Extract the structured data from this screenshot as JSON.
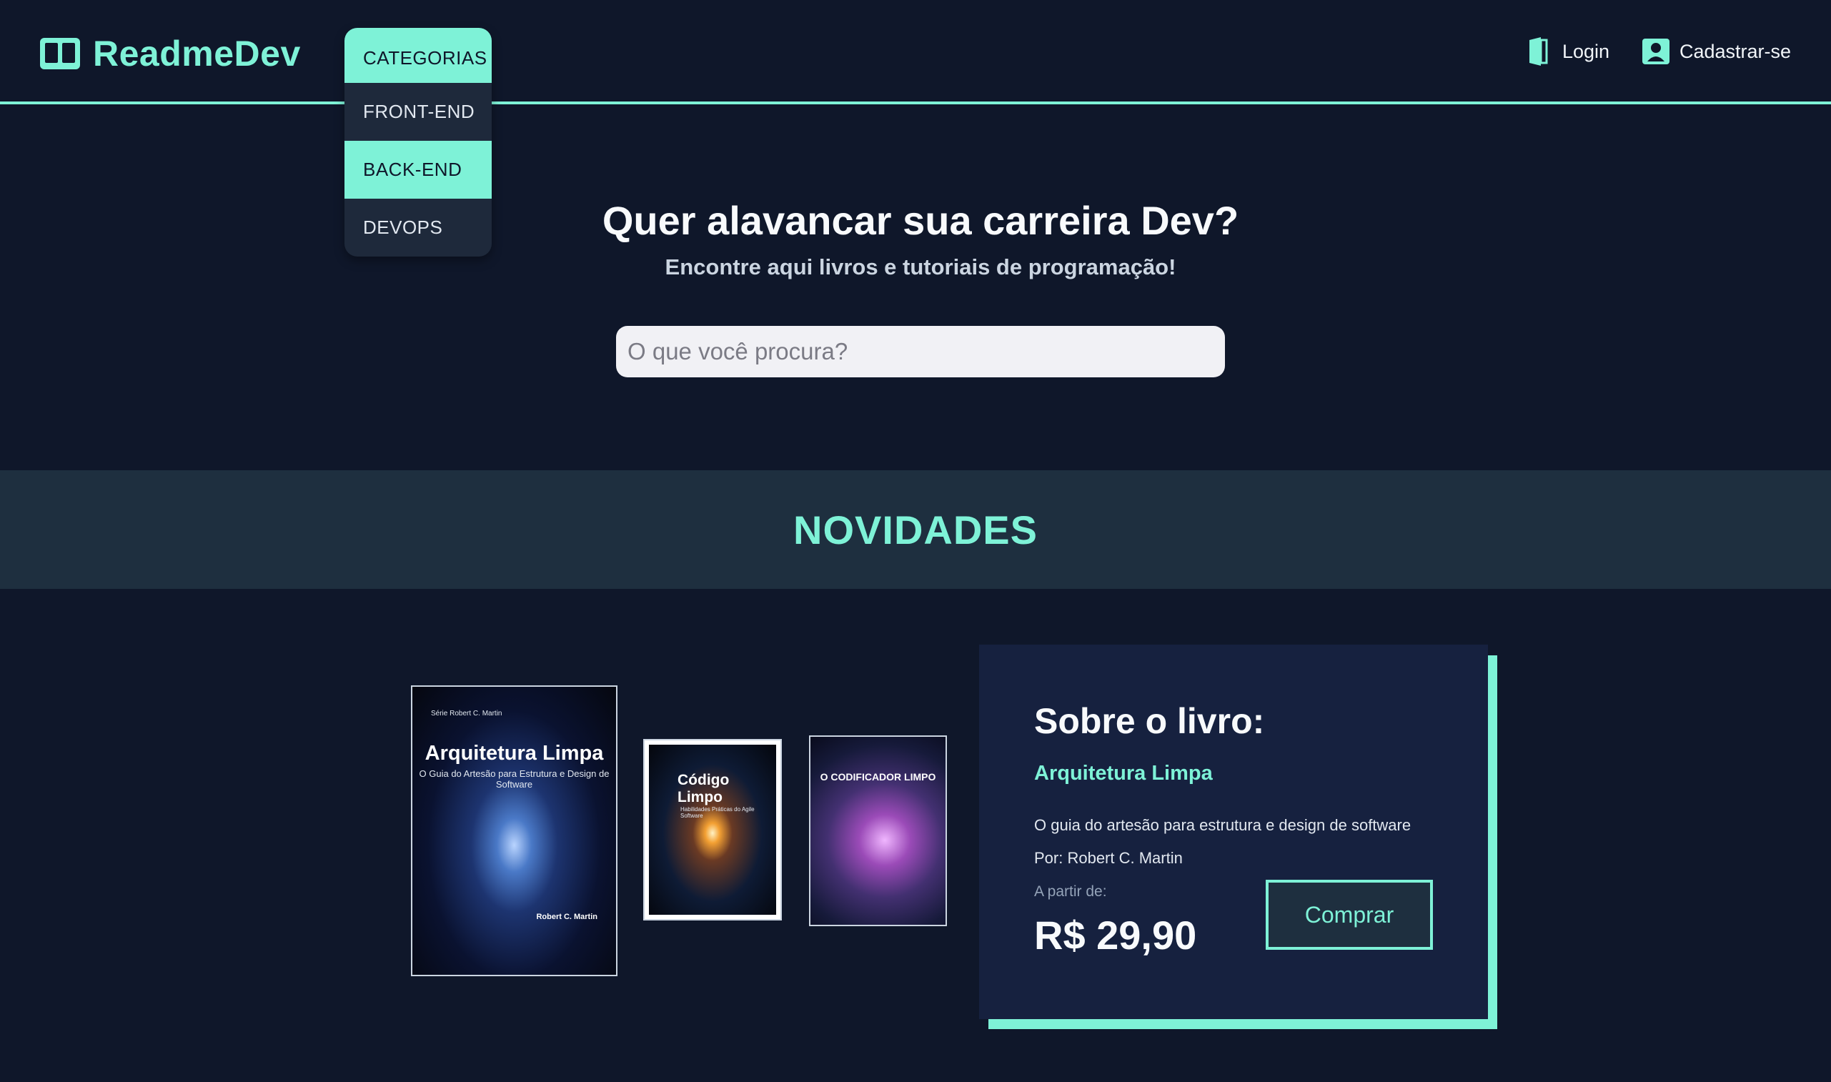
{
  "brand": {
    "name": "ReadmeDev",
    "icon": "book-open-icon"
  },
  "categories": {
    "label": "CATEGORIAS",
    "items": [
      {
        "label": "FRONT-END",
        "active": false
      },
      {
        "label": "BACK-END",
        "active": true
      },
      {
        "label": "DEVOPS",
        "active": false
      }
    ]
  },
  "nav": {
    "login": {
      "label": "Login",
      "icon": "door-icon"
    },
    "signup": {
      "label": "Cadastrar-se",
      "icon": "user-icon"
    }
  },
  "hero": {
    "title": "Quer alavancar sua carreira Dev?",
    "subtitle": "Encontre aqui livros e tutoriais de programação!",
    "search_placeholder": "O que você procura?"
  },
  "section": {
    "title": "NOVIDADES"
  },
  "books": [
    {
      "title": "Arquitetura Limpa",
      "series": "Série Robert C. Martin",
      "subtitle": "O Guia do Artesão para Estrutura e Design de Software",
      "author": "Robert C. Martin"
    },
    {
      "title": "Código Limpo",
      "subtitle": "Habilidades Práticas do Agile Software"
    },
    {
      "title": "O CODIFICADOR LIMPO"
    }
  ],
  "about": {
    "heading": "Sobre o livro:",
    "book_title": "Arquitetura Limpa",
    "description": "O guia do artesão para estrutura e design de software",
    "author": "Por: Robert C. Martin",
    "price_label": "A partir de:",
    "price": "R$ 29,90",
    "buy_label": "Comprar"
  },
  "colors": {
    "accent": "#7ef2d7",
    "background": "#0f172a",
    "card": "#16213f",
    "band": "#1e2f3f"
  }
}
